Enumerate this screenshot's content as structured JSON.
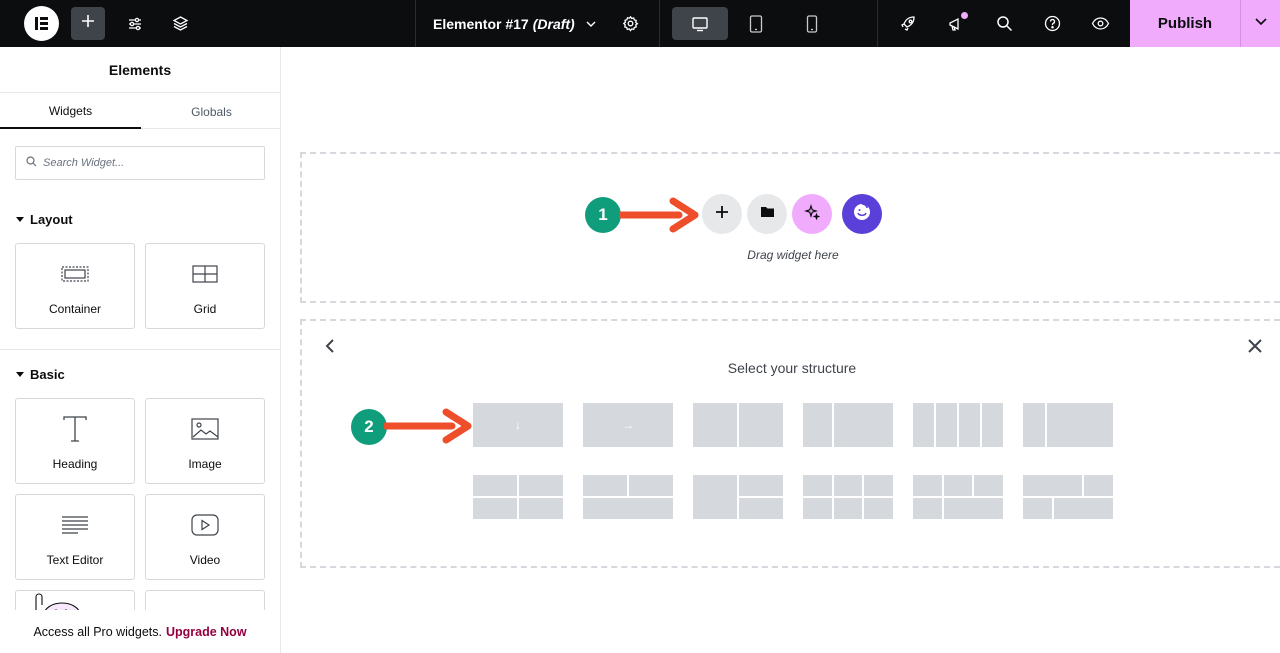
{
  "topbar": {
    "document_title": "Elementor #17",
    "document_status": "(Draft)",
    "publish_label": "Publish",
    "icons": [
      "elementor-logo-icon",
      "plus-icon",
      "sliders-icon",
      "layers-icon",
      "chevron-down-icon",
      "gear-icon",
      "desktop-icon",
      "tablet-icon",
      "mobile-icon",
      "rocket-icon",
      "megaphone-icon",
      "search-icon",
      "help-icon",
      "eye-icon",
      "chevron-down-icon"
    ],
    "accent_color": "#f0abfc"
  },
  "sidebar": {
    "title": "Elements",
    "tabs": [
      {
        "label": "Widgets",
        "active": true
      },
      {
        "label": "Globals",
        "active": false
      }
    ],
    "search_placeholder": "Search Widget...",
    "categories": [
      {
        "label": "Layout",
        "widgets": [
          {
            "label": "Container",
            "icon": "container-icon"
          },
          {
            "label": "Grid",
            "icon": "grid-icon"
          }
        ]
      },
      {
        "label": "Basic",
        "widgets": [
          {
            "label": "Heading",
            "icon": "heading-icon"
          },
          {
            "label": "Image",
            "icon": "image-icon"
          },
          {
            "label": "Text Editor",
            "icon": "text-editor-icon"
          },
          {
            "label": "Video",
            "icon": "video-icon"
          }
        ]
      }
    ],
    "promo_text": "Access all Pro widgets.",
    "promo_link": "Upgrade Now"
  },
  "canvas": {
    "step1": "1",
    "step2": "2",
    "drag_text": "Drag widget here",
    "add_buttons": [
      "add-section-icon",
      "template-library-icon",
      "ai-sparkle-icon",
      "assistant-face-icon"
    ],
    "structure_title": "Select your structure",
    "structure_presets_row1": [
      "vertical-flow",
      "horizontal-flow",
      "two-columns",
      "one-third-two-thirds",
      "four-columns",
      "one-fourth-three-fourths"
    ],
    "structure_presets_row2": [
      "two-by-two",
      "one-over-two",
      "left-tall-right-stacked",
      "three-by-two",
      "two-over-three",
      "one-and-three-rows"
    ],
    "step_color": "#0f9d7c",
    "arrow_color": "#ef4e2b"
  }
}
